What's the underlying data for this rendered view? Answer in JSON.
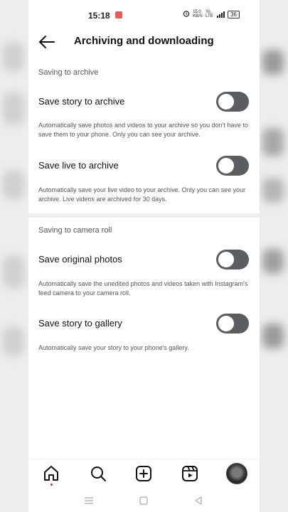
{
  "status_bar": {
    "time": "15:18",
    "net_speed": "15.0 KB/S",
    "network": "Yo LTE",
    "battery": "36"
  },
  "header": {
    "title": "Archiving and downloading",
    "back_icon": "arrow-left-icon"
  },
  "sections": {
    "archive": {
      "title": "Saving to archive",
      "items": [
        {
          "label": "Save story to archive",
          "description": "Automatically save photos and videos to your archive so you don't have to save them to your phone. Only you can see your archive.",
          "enabled": false
        },
        {
          "label": "Save live to archive",
          "description": "Automatically save your live video to your archive. Only you can see your archive. Live videos are archived for 30 days.",
          "enabled": false
        }
      ]
    },
    "camera_roll": {
      "title": "Saving to camera roll",
      "items": [
        {
          "label": "Save original photos",
          "description": "Automatically save the unedited photos and videos taken with Instagram's feed camera to your camera roll.",
          "enabled": false
        },
        {
          "label": "Save story to gallery",
          "description": "Automatically save your story to your phone's gallery.",
          "enabled": false
        }
      ]
    }
  },
  "bottom_nav": {
    "items": [
      "home-icon",
      "search-icon",
      "create-post-icon",
      "reels-icon",
      "profile-avatar"
    ],
    "notification_dot_color": "#e0204f"
  },
  "colors": {
    "toggle_off": "#5a5d62",
    "background": "#ffffff",
    "secondary_text": "#555555"
  }
}
